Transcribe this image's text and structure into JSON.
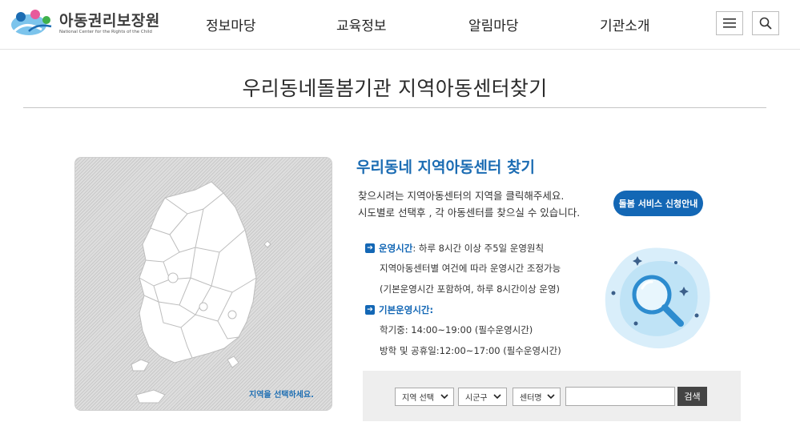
{
  "header": {
    "logo_main": "아동권리보장원",
    "logo_sub": "National Center for the Rights of the Child",
    "nav": [
      "정보마당",
      "교육정보",
      "알림마당",
      "기관소개"
    ]
  },
  "page": {
    "title": "우리동네돌봄기관 지역아동센터찾기"
  },
  "map": {
    "hint": "지역을 선택하세요."
  },
  "panel": {
    "section_title": "우리동네 지역아동센터 찾기",
    "description": [
      "찾으시려는 지역아동센터의 지역을 클릭해주세요.",
      "시도별로 선택후 , 각 아동센터를 찾으실 수 있습니다."
    ],
    "apply_button": "돌봄 서비스 신청안내",
    "operating": {
      "label": "운영시간",
      "text": " : 하루 8시간 이상 주5일 운영원칙",
      "lines": [
        "지역아동센터별 여건에 따라 운영시간 조정가능",
        "(기본운영시간 포함하여, 하루 8시간이상 운영)"
      ]
    },
    "basic": {
      "label": "기본운영시간:",
      "lines": [
        "학기중: 14:00~19:00 (필수운영시간)",
        "방학 및 공휴일:12:00~17:00 (필수운영시간)"
      ]
    }
  },
  "search": {
    "region_select": "지역 선택",
    "city_select": "시군구",
    "center_select": "센터명",
    "input_value": "",
    "button": "검색"
  },
  "colors": {
    "accent": "#1367b5",
    "title_blue": "#1b6cb3",
    "search_bg": "#eeeeee"
  }
}
